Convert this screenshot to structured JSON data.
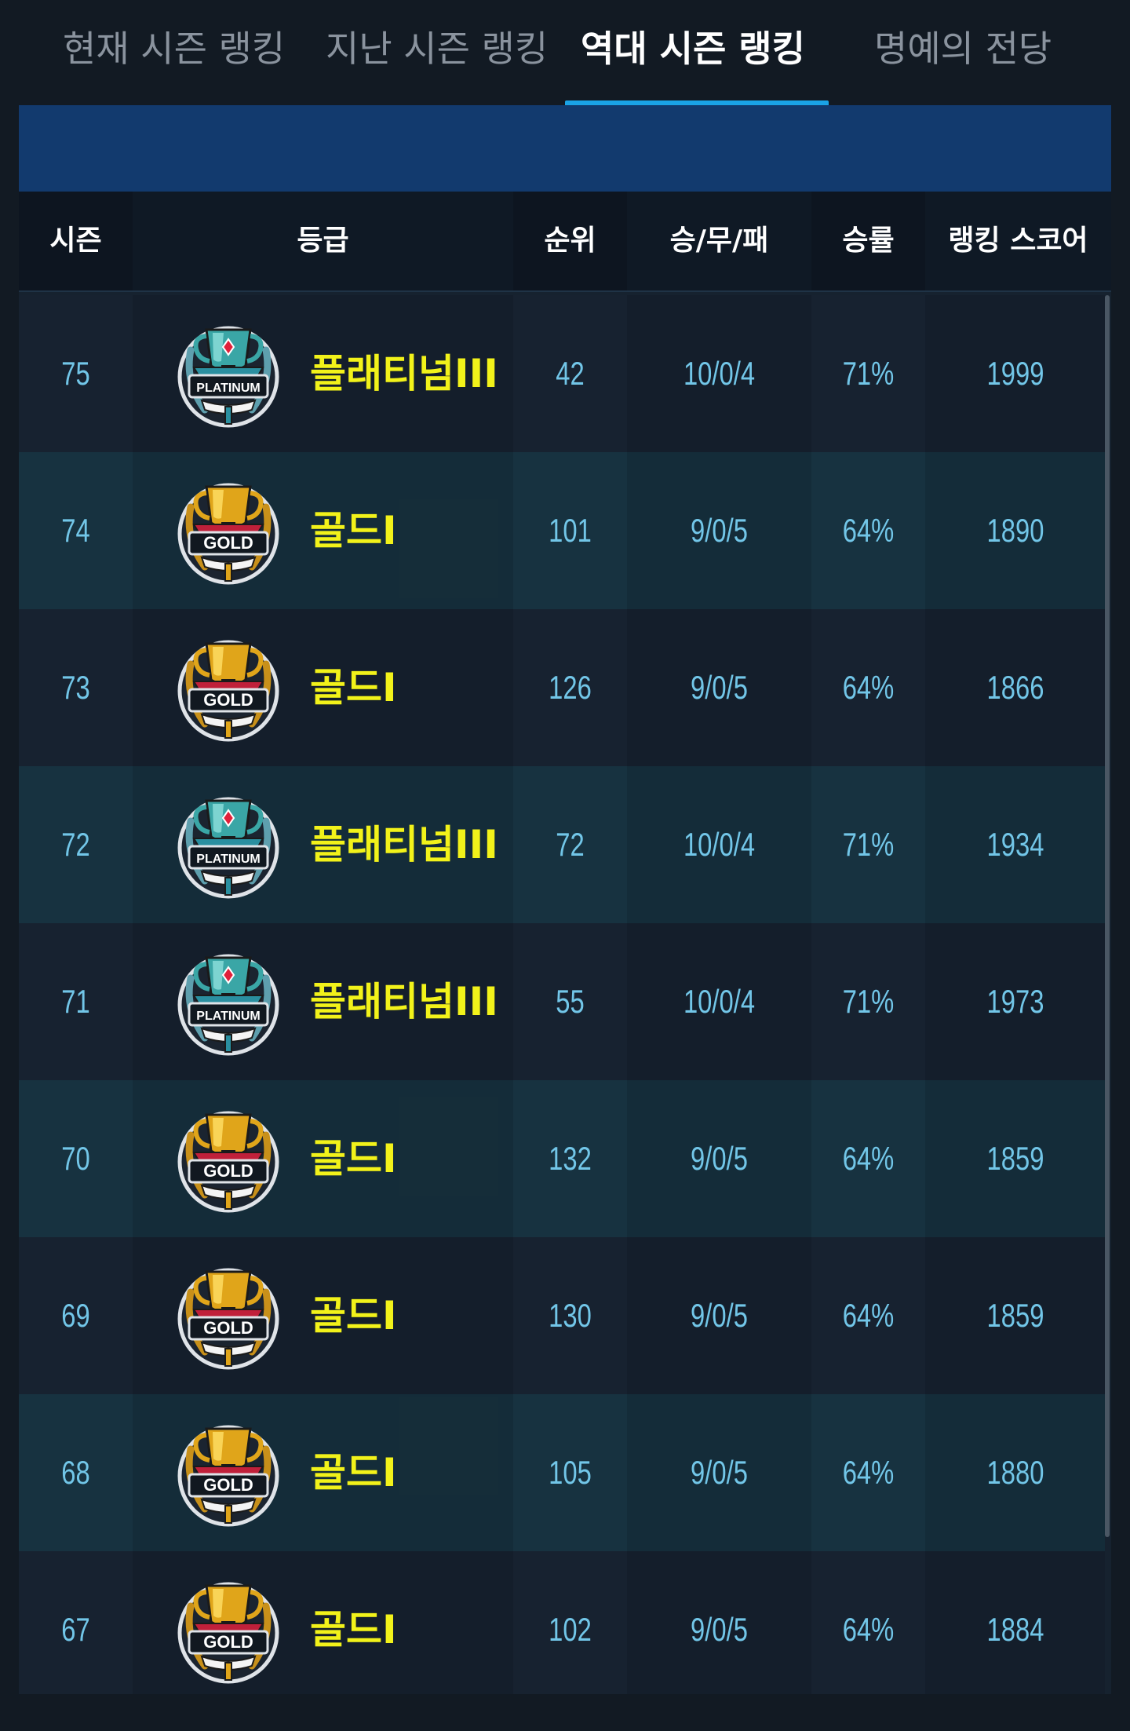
{
  "tabs": [
    {
      "label": "현재 시즌 랭킹",
      "active": false
    },
    {
      "label": "지난 시즌 랭킹",
      "active": false
    },
    {
      "label": "역대 시즌 랭킹",
      "active": true
    },
    {
      "label": "명예의 전당",
      "active": false
    }
  ],
  "table": {
    "headers": [
      "시즌",
      "등급",
      "순위",
      "승/무/패",
      "승률",
      "랭킹 스코어"
    ],
    "rows": [
      {
        "season": "75",
        "tier": "platinum",
        "grade": "플래티넘III",
        "badge_text": "PLATINUM",
        "rank": "42",
        "record": "10/0/4",
        "win_rate": "71%",
        "score": "1999"
      },
      {
        "season": "74",
        "tier": "gold",
        "grade": "골드I",
        "badge_text": "GOLD",
        "rank": "101",
        "record": "9/0/5",
        "win_rate": "64%",
        "score": "1890"
      },
      {
        "season": "73",
        "tier": "gold",
        "grade": "골드I",
        "badge_text": "GOLD",
        "rank": "126",
        "record": "9/0/5",
        "win_rate": "64%",
        "score": "1866"
      },
      {
        "season": "72",
        "tier": "platinum",
        "grade": "플래티넘III",
        "badge_text": "PLATINUM",
        "rank": "72",
        "record": "10/0/4",
        "win_rate": "71%",
        "score": "1934"
      },
      {
        "season": "71",
        "tier": "platinum",
        "grade": "플래티넘III",
        "badge_text": "PLATINUM",
        "rank": "55",
        "record": "10/0/4",
        "win_rate": "71%",
        "score": "1973"
      },
      {
        "season": "70",
        "tier": "gold",
        "grade": "골드I",
        "badge_text": "GOLD",
        "rank": "132",
        "record": "9/0/5",
        "win_rate": "64%",
        "score": "1859"
      },
      {
        "season": "69",
        "tier": "gold",
        "grade": "골드I",
        "badge_text": "GOLD",
        "rank": "130",
        "record": "9/0/5",
        "win_rate": "64%",
        "score": "1859"
      },
      {
        "season": "68",
        "tier": "gold",
        "grade": "골드I",
        "badge_text": "GOLD",
        "rank": "105",
        "record": "9/0/5",
        "win_rate": "64%",
        "score": "1880"
      },
      {
        "season": "67",
        "tier": "gold",
        "grade": "골드I",
        "badge_text": "GOLD",
        "rank": "102",
        "record": "9/0/5",
        "win_rate": "64%",
        "score": "1884"
      }
    ]
  },
  "colors": {
    "background": "#121a23",
    "accent_underline": "#1aa3e6",
    "banner": "#123a6e",
    "value_text": "#72c6e8",
    "grade_text": "#f2f21a"
  },
  "icons": {
    "platinum": "platinum-trophy-badge-icon",
    "gold": "gold-trophy-badge-icon"
  }
}
